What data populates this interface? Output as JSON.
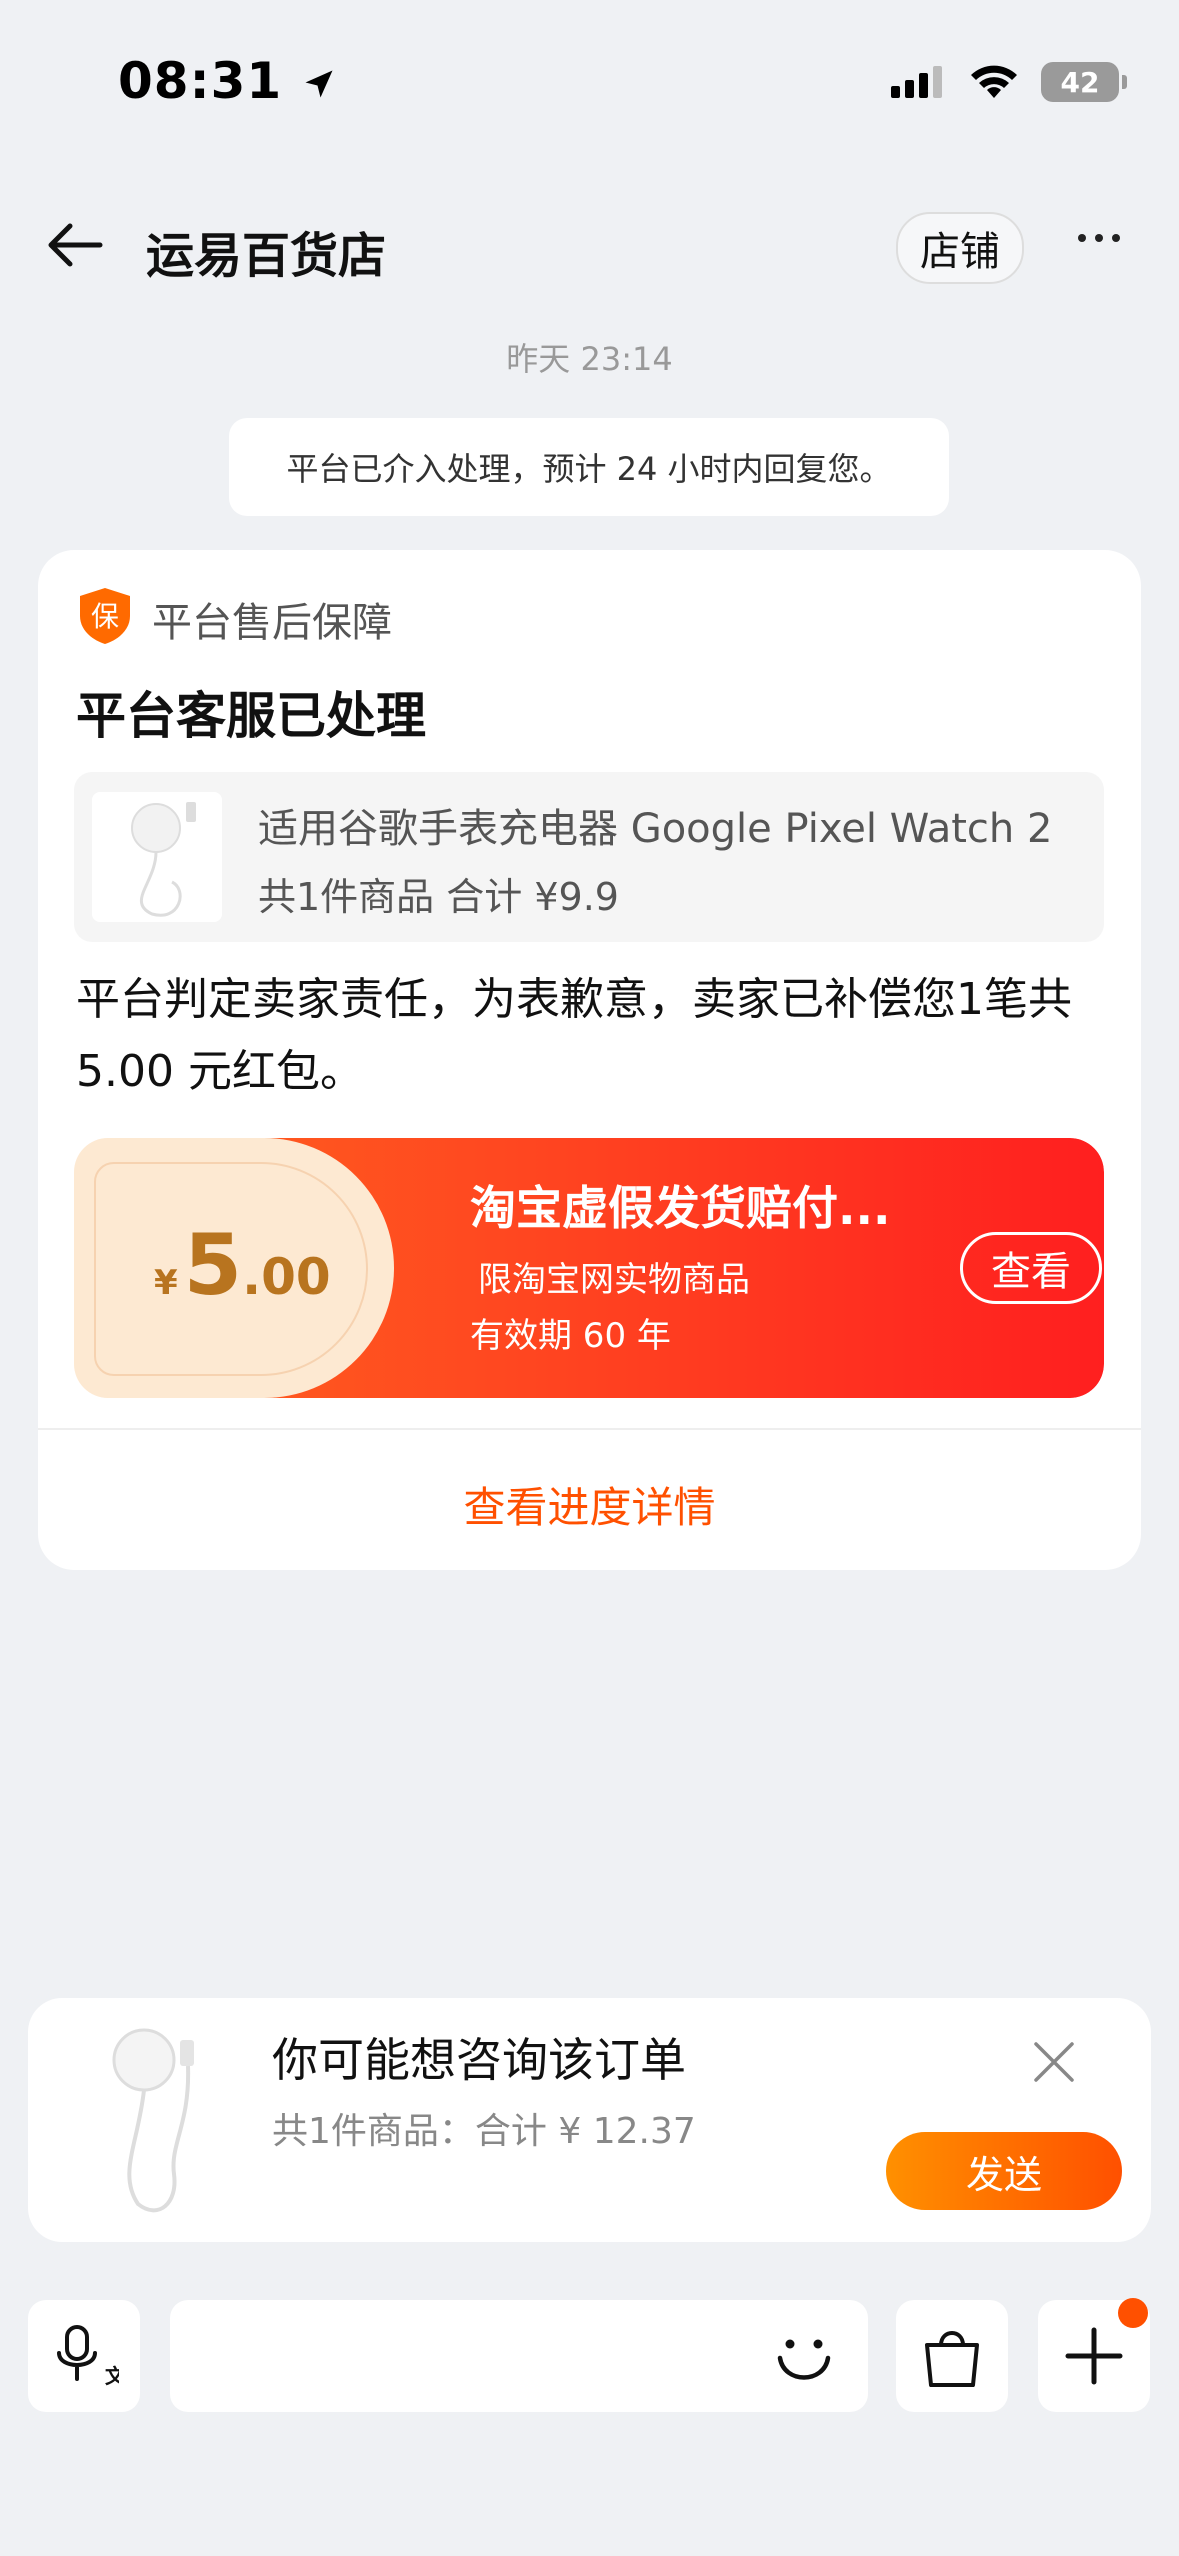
{
  "status_bar": {
    "time": "08:31",
    "battery": "42"
  },
  "header": {
    "title": "运易百货店",
    "shop_button": "店铺"
  },
  "timestamp": "昨天 23:14",
  "system_message": "平台已介入处理，预计 24 小时内回复您。",
  "card": {
    "label": "平台售后保障",
    "badge": "保",
    "title": "平台客服已处理",
    "product_name": "适用谷歌手表充电器 Google Pixel Watch 2",
    "product_summary": "共1件商品  合计 ¥9.9",
    "verdict": "平台判定卖家责任，为表歉意，卖家已补偿您1笔共 5.00 元红包。",
    "coupon": {
      "currency": "¥",
      "amount_int": "5",
      "amount_dec": ".00",
      "name": "淘宝虚假发货赔付...",
      "line1": "限淘宝网实物商品",
      "line2": "有效期 60 年",
      "view_label": "查看"
    },
    "progress_link": "查看进度详情"
  },
  "suggestion": {
    "title": "你可能想咨询该订单",
    "summary": "共1件商品：合计 ¥ 12.37",
    "send_label": "发送"
  },
  "colors": {
    "accent": "#ff5000",
    "coupon_red": "#ff3a20",
    "price_gold": "#b8741f"
  },
  "icons": [
    "location-arrow-icon",
    "signal-icon",
    "wifi-icon",
    "back-arrow-icon",
    "more-icon",
    "shield-icon",
    "close-icon",
    "voice-icon",
    "emoji-icon",
    "bag-icon",
    "plus-icon"
  ]
}
